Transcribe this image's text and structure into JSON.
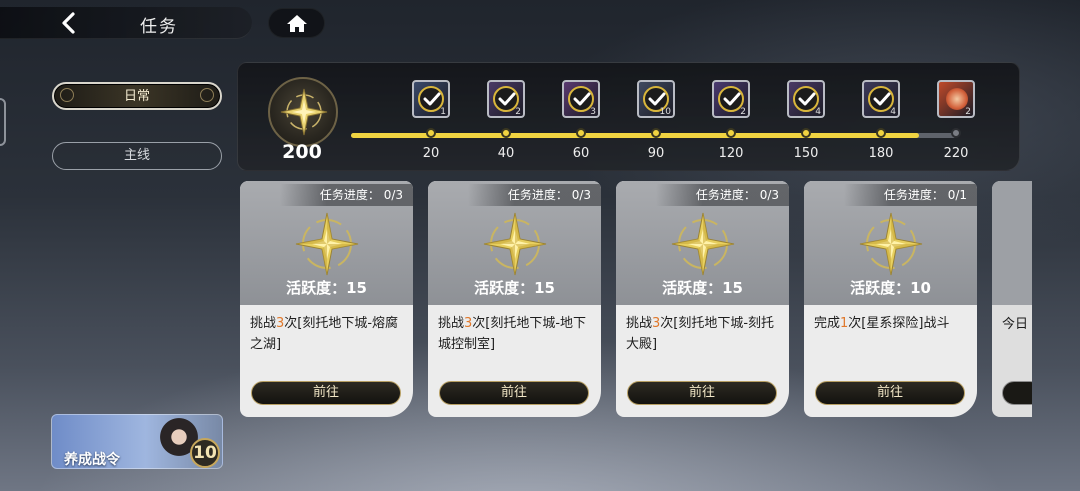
{
  "header": {
    "title": "任务"
  },
  "tabs": [
    {
      "label": "日常",
      "active": true
    },
    {
      "label": "主线",
      "active": false
    }
  ],
  "activity": {
    "total": "200",
    "progress": 200,
    "max": 220,
    "milestones": [
      {
        "value": "20",
        "qty": "1",
        "claimed": true,
        "icon": "check-icon"
      },
      {
        "value": "40",
        "qty": "2",
        "claimed": true,
        "icon": "check-icon"
      },
      {
        "value": "60",
        "qty": "3",
        "claimed": true,
        "icon": "check-icon"
      },
      {
        "value": "90",
        "qty": "10",
        "claimed": true,
        "icon": "check-icon"
      },
      {
        "value": "120",
        "qty": "2",
        "claimed": true,
        "icon": "check-icon"
      },
      {
        "value": "150",
        "qty": "4",
        "claimed": true,
        "icon": "check-icon"
      },
      {
        "value": "180",
        "qty": "4",
        "claimed": true,
        "icon": "check-icon"
      },
      {
        "value": "220",
        "qty": "2",
        "claimed": false,
        "icon": "reward-item-icon"
      }
    ]
  },
  "tasks": [
    {
      "progress_label": "任务进度：",
      "progress": "0/3",
      "activity": "活跃度：15",
      "desc_pre": "挑战",
      "count": "3",
      "desc_post": "次[刻托地下城-熔腐之湖]",
      "button": "前往"
    },
    {
      "progress_label": "任务进度：",
      "progress": "0/3",
      "activity": "活跃度：15",
      "desc_pre": "挑战",
      "count": "3",
      "desc_post": "次[刻托地下城-地下城控制室]",
      "button": "前往"
    },
    {
      "progress_label": "任务进度：",
      "progress": "0/3",
      "activity": "活跃度：15",
      "desc_pre": "挑战",
      "count": "3",
      "desc_post": "次[刻托地下城-刻托大殿]",
      "button": "前往"
    },
    {
      "progress_label": "任务进度：",
      "progress": "0/1",
      "activity": "活跃度：10",
      "desc_pre": "完成",
      "count": "1",
      "desc_post": "次[星系探险]战斗",
      "button": "前往"
    }
  ],
  "partial_task": {
    "desc": "今日"
  },
  "battle_pass": {
    "label": "养成战令",
    "level": "10"
  },
  "colors": {
    "accent": "#f0d341",
    "highlight": "#e0782b",
    "button_border": "#b79f63"
  }
}
